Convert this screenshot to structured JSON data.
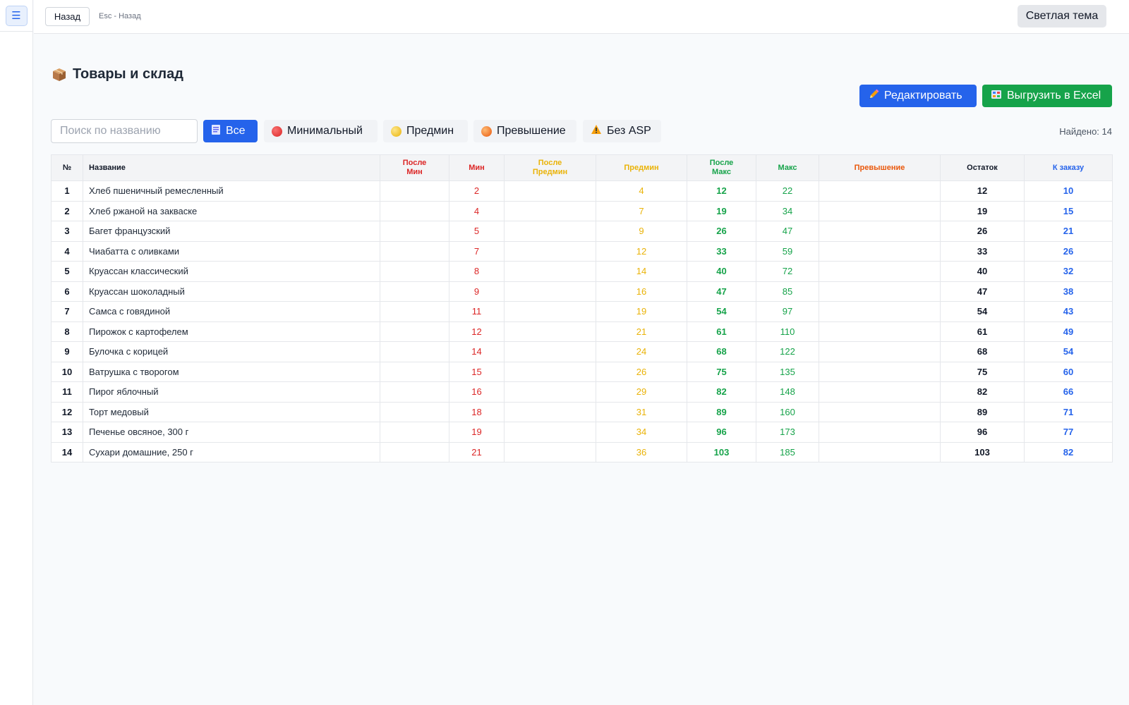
{
  "sidebar": {
    "menu_icon": "☰"
  },
  "topbar": {
    "back_label": "Назад",
    "hint": "Esc - Назад",
    "theme_label": "Светлая тема"
  },
  "page": {
    "title": "Товары и склад",
    "edit_label": "Редактировать",
    "excel_label": "Выгрузить в Excel"
  },
  "filters": {
    "search_placeholder": "Поиск по названию",
    "all": "Все",
    "min": "Минимальный",
    "premin": "Предмин",
    "excess": "Превышение",
    "noasp": "Без ASP",
    "found": "Найдено: 14"
  },
  "colors": {
    "accent": "#2563eb",
    "success": "#16a34a",
    "min": "#dc2626",
    "premin": "#eab308",
    "excess": "#ea580c"
  },
  "table": {
    "headers": {
      "num": "№",
      "name": "Название",
      "after_min_1": "После",
      "after_min_2": "Мин",
      "min": "Мин",
      "after_premin_1": "После",
      "after_premin_2": "Предмин",
      "premin": "Предмин",
      "after_max_1": "После",
      "after_max_2": "Макс",
      "max": "Макс",
      "excess": "Превышение",
      "stock": "Остаток",
      "order": "К заказу"
    },
    "rows": [
      {
        "n": "1",
        "name": "Хлеб пшеничный ремесленный",
        "after_min": "",
        "min": "2",
        "after_premin": "",
        "premin": "4",
        "after_max": "12",
        "max": "22",
        "excess": "",
        "stock": "12",
        "order": "10"
      },
      {
        "n": "2",
        "name": "Хлеб ржаной на закваске",
        "after_min": "",
        "min": "4",
        "after_premin": "",
        "premin": "7",
        "after_max": "19",
        "max": "34",
        "excess": "",
        "stock": "19",
        "order": "15"
      },
      {
        "n": "3",
        "name": "Багет французский",
        "after_min": "",
        "min": "5",
        "after_premin": "",
        "premin": "9",
        "after_max": "26",
        "max": "47",
        "excess": "",
        "stock": "26",
        "order": "21"
      },
      {
        "n": "4",
        "name": "Чиабатта с оливками",
        "after_min": "",
        "min": "7",
        "after_premin": "",
        "premin": "12",
        "after_max": "33",
        "max": "59",
        "excess": "",
        "stock": "33",
        "order": "26"
      },
      {
        "n": "5",
        "name": "Круассан классический",
        "after_min": "",
        "min": "8",
        "after_premin": "",
        "premin": "14",
        "after_max": "40",
        "max": "72",
        "excess": "",
        "stock": "40",
        "order": "32"
      },
      {
        "n": "6",
        "name": "Круассан шоколадный",
        "after_min": "",
        "min": "9",
        "after_premin": "",
        "premin": "16",
        "after_max": "47",
        "max": "85",
        "excess": "",
        "stock": "47",
        "order": "38"
      },
      {
        "n": "7",
        "name": "Самса с говядиной",
        "after_min": "",
        "min": "11",
        "after_premin": "",
        "premin": "19",
        "after_max": "54",
        "max": "97",
        "excess": "",
        "stock": "54",
        "order": "43"
      },
      {
        "n": "8",
        "name": "Пирожок с картофелем",
        "after_min": "",
        "min": "12",
        "after_premin": "",
        "premin": "21",
        "after_max": "61",
        "max": "110",
        "excess": "",
        "stock": "61",
        "order": "49"
      },
      {
        "n": "9",
        "name": "Булочка с корицей",
        "after_min": "",
        "min": "14",
        "after_premin": "",
        "premin": "24",
        "after_max": "68",
        "max": "122",
        "excess": "",
        "stock": "68",
        "order": "54"
      },
      {
        "n": "10",
        "name": "Ватрушка с творогом",
        "after_min": "",
        "min": "15",
        "after_premin": "",
        "premin": "26",
        "after_max": "75",
        "max": "135",
        "excess": "",
        "stock": "75",
        "order": "60"
      },
      {
        "n": "11",
        "name": "Пирог яблочный",
        "after_min": "",
        "min": "16",
        "after_premin": "",
        "premin": "29",
        "after_max": "82",
        "max": "148",
        "excess": "",
        "stock": "82",
        "order": "66"
      },
      {
        "n": "12",
        "name": "Торт медовый",
        "after_min": "",
        "min": "18",
        "after_premin": "",
        "premin": "31",
        "after_max": "89",
        "max": "160",
        "excess": "",
        "stock": "89",
        "order": "71"
      },
      {
        "n": "13",
        "name": "Печенье овсяное, 300 г",
        "after_min": "",
        "min": "19",
        "after_premin": "",
        "premin": "34",
        "after_max": "96",
        "max": "173",
        "excess": "",
        "stock": "96",
        "order": "77"
      },
      {
        "n": "14",
        "name": "Сухари домашние, 250 г",
        "after_min": "",
        "min": "21",
        "after_premin": "",
        "premin": "36",
        "after_max": "103",
        "max": "185",
        "excess": "",
        "stock": "103",
        "order": "82"
      }
    ]
  }
}
